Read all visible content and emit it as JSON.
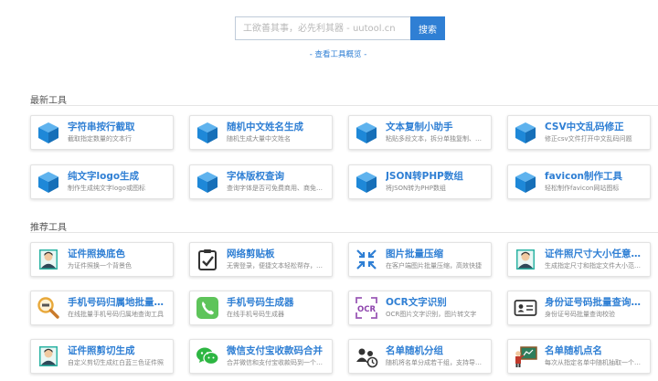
{
  "search": {
    "placeholder": "工欲善其事，必先利其器 - uutool.cn",
    "button_label": "搜索"
  },
  "overview_link": "- 查看工具概览 -",
  "sections": {
    "latest": {
      "title": "最新工具",
      "tools": [
        {
          "name": "字符串按行截取",
          "desc": "截取指定数量的文本行",
          "icon": "cube-icon"
        },
        {
          "name": "随机中文姓名生成",
          "desc": "随机生成大量中文姓名",
          "icon": "cube-icon"
        },
        {
          "name": "文本复制小助手",
          "desc": "粘贴多段文本，拆分单独复制、文...",
          "icon": "cube-icon"
        },
        {
          "name": "CSV中文乱码修正",
          "desc": "修正csv文件打开中文乱码问题",
          "icon": "cube-icon"
        },
        {
          "name": "纯文字logo生成",
          "desc": "制作生成纯文字logo或图标",
          "icon": "cube-icon"
        },
        {
          "name": "字体版权查询",
          "desc": "查询字体是否可免费商用、商免版...",
          "icon": "cube-icon"
        },
        {
          "name": "JSON转PHP数组",
          "desc": "将JSON转为PHP数组",
          "icon": "cube-icon"
        },
        {
          "name": "favicon制作工具",
          "desc": "轻松制作favicon网站图标",
          "icon": "cube-icon"
        }
      ]
    },
    "recommended": {
      "title": "推荐工具",
      "tools": [
        {
          "name": "证件照换底色",
          "desc": "为证件照换一个背景色",
          "icon": "id-photo-icon"
        },
        {
          "name": "网络剪贴板",
          "desc": "无需登录，便捷文本轻松帮存，文...",
          "icon": "clipboard-check-icon"
        },
        {
          "name": "图片批量压缩",
          "desc": "在客户端图片批量压缩，高效快捷",
          "icon": "compress-arrows-icon"
        },
        {
          "name": "证件照尺寸大小任意修改",
          "desc": "生成指定尺寸和指定文件大小范围...",
          "icon": "id-photo-icon"
        },
        {
          "name": "手机号码归属地批量查询",
          "desc": "在线批量手机号码归属地查询工具",
          "icon": "magnifier-icon"
        },
        {
          "name": "手机号码生成器",
          "desc": "在线手机号码生成器",
          "icon": "phone-icon"
        },
        {
          "name": "OCR文字识别",
          "desc": "OCR图片文字识别，图片转文字",
          "icon": "ocr-icon"
        },
        {
          "name": "身份证号码批量查询校验",
          "desc": "身份证号码批量查询校验",
          "icon": "id-card-icon"
        },
        {
          "name": "证件照剪切生成",
          "desc": "自定义剪切生成红白蓝三色证件照",
          "icon": "id-photo-icon"
        },
        {
          "name": "微信支付宝收款码合并",
          "desc": "合并微信和支付宝收款码到一个图...",
          "icon": "wechat-icon"
        },
        {
          "name": "名单随机分组",
          "desc": "随机将名单分成若干组，支持导出...",
          "icon": "people-group-icon"
        },
        {
          "name": "名单随机点名",
          "desc": "每次从指定名单中随机抽取一个名...",
          "icon": "teacher-board-icon"
        }
      ]
    }
  },
  "colors": {
    "accent": "#2f7fd4",
    "cube": "#1e88d8"
  }
}
